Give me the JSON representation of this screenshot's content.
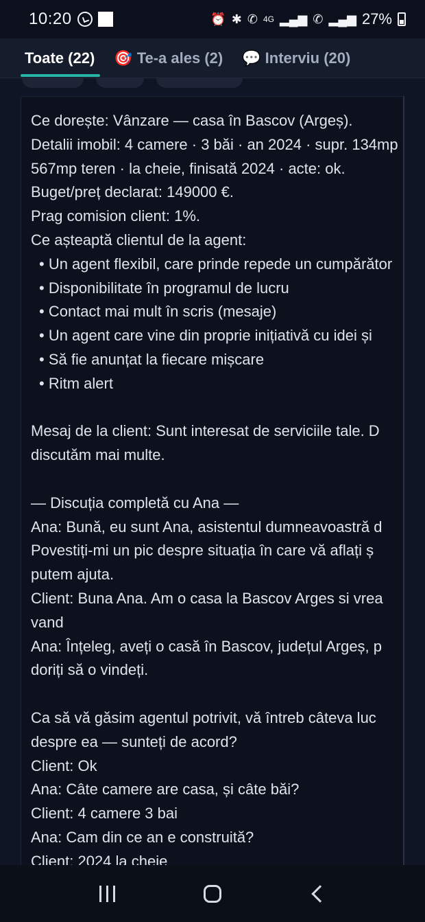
{
  "status_bar": {
    "time": "10:20",
    "battery": "27%",
    "network": "4G"
  },
  "tabs": [
    {
      "label": "Toate (22)",
      "emoji": ""
    },
    {
      "label": "Te-a ales (2)",
      "emoji": "🎯"
    },
    {
      "label": "Interviu (20)",
      "emoji": "💬"
    }
  ],
  "message": {
    "lines": [
      "Ce dorește: Vânzare — casa în Bascov (Argeș).",
      "Detalii imobil: 4 camere · 3 băi · an 2024 · supr. 134mp",
      "567mp teren · la cheie, finisată 2024 · acte: ok.",
      "Buget/preț declarat: 149000 €.",
      "Prag comision client: 1%.",
      "Ce așteaptă clientul de la agent:",
      "• Un agent flexibil, care prinde repede un cumpărător",
      "• Disponibilitate în programul de lucru",
      "• Contact mai mult în scris (mesaje)",
      "• Un agent care vine din proprie inițiativă cu idei și",
      "• Să fie anunțat la fiecare mișcare",
      "• Ritm alert",
      "",
      "Mesaj de la client: Sunt interesat de serviciile tale. D",
      "discutăm mai multe.",
      "",
      "— Discuția completă cu Ana —",
      "Ana: Bună, eu sunt Ana, asistentul dumneavoastră d",
      "Povestiți-mi un pic despre situația în care vă aflați ș",
      "putem ajuta.",
      "Client: Buna Ana. Am o casa la Bascov Arges si vrea",
      "vand",
      "Ana: Înțeleg, aveți o casă în Bascov, județul Argeș, p",
      "doriți să o vindeți.",
      "",
      "Ca să vă găsim agentul potrivit, vă întreb câteva luc",
      "despre ea — sunteți de acord?",
      "Client: Ok",
      "Ana: Câte camere are casa, și câte băi?",
      "Client: 4 camere 3 bai",
      "Ana: Cam din ce an e construită?",
      "Client: 2024 la cheie"
    ]
  }
}
